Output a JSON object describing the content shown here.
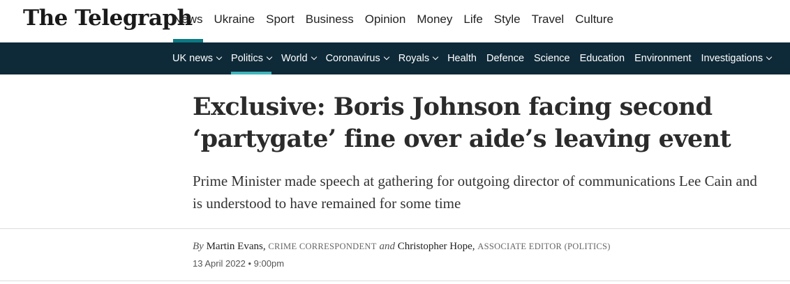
{
  "site": {
    "logo": "The Telegraph"
  },
  "primary_nav": {
    "items": [
      {
        "label": "News",
        "active": true
      },
      {
        "label": "Ukraine"
      },
      {
        "label": "Sport"
      },
      {
        "label": "Business"
      },
      {
        "label": "Opinion"
      },
      {
        "label": "Money"
      },
      {
        "label": "Life"
      },
      {
        "label": "Style"
      },
      {
        "label": "Travel"
      },
      {
        "label": "Culture"
      }
    ]
  },
  "secondary_nav": {
    "items": [
      {
        "label": "UK news",
        "dropdown": true
      },
      {
        "label": "Politics",
        "dropdown": true,
        "active": true
      },
      {
        "label": "World",
        "dropdown": true
      },
      {
        "label": "Coronavirus",
        "dropdown": true
      },
      {
        "label": "Royals",
        "dropdown": true
      },
      {
        "label": "Health"
      },
      {
        "label": "Defence"
      },
      {
        "label": "Science"
      },
      {
        "label": "Education"
      },
      {
        "label": "Environment"
      },
      {
        "label": "Investigations",
        "dropdown": true
      }
    ]
  },
  "article": {
    "headline": "Exclusive: Boris Johnson facing second ‘partygate’ fine over aide’s leaving event",
    "standfirst": "Prime Minister made speech at gathering for outgoing director of communications Lee Cain and is understood to have remained for some time",
    "byline": {
      "by": "By",
      "and": "and",
      "authors": [
        {
          "name": "Martin Evans",
          "role": "CRIME CORRESPONDENT"
        },
        {
          "name": "Christopher Hope",
          "role": "ASSOCIATE EDITOR (POLITICS)"
        }
      ]
    },
    "date": "13 April 2022 • 9:00pm"
  },
  "colors": {
    "nav_bar": "#0e2a38",
    "accent": "#0c7a83"
  }
}
